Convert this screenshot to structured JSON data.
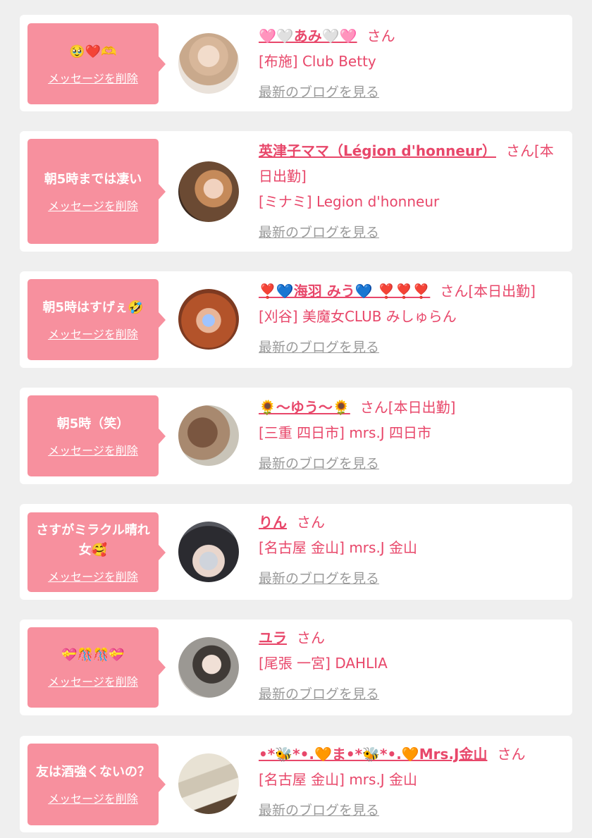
{
  "ui": {
    "delete_label": "メッセージを削除",
    "blog_label": "最新のブログを見る"
  },
  "messages": [
    {
      "message": "🥹❤️🫶",
      "name": "🩷🤍あみ🤍🩷",
      "honorific": "さん",
      "shop": "[布施] Club Betty",
      "avatar": "avatar-blonde-woman"
    },
    {
      "message": "朝5時までは凄い",
      "name": "英津子ママ（Légion d'honneur）",
      "honorific": "さん[本日出勤]",
      "shop": "[ミナミ] Legion d'honneur",
      "avatar": "avatar-woman-indoor"
    },
    {
      "message": "朝5時はすげぇ🤣",
      "name": "❣️💙海羽 みう💙 ❣️❣️❣️",
      "honorific": "さん[本日出勤]",
      "shop": "[刈谷] 美魔女CLUB みしゅらん",
      "avatar": "avatar-auburn-hair"
    },
    {
      "message": "朝5時（笑）",
      "name": "🌻～ゆう～🌻",
      "honorific": "さん[本日出勤]",
      "shop": "[三重 四日市] mrs.J 四日市",
      "avatar": "avatar-long-wavy-hair"
    },
    {
      "message": "さすがミラクル晴れ女🥰",
      "name": "りん",
      "honorific": "さん",
      "shop": "[名古屋 金山] mrs.J 金山",
      "avatar": "avatar-dark-hair-ng"
    },
    {
      "message": "💝🎊🎊💝",
      "name": "ユラ",
      "honorific": "さん",
      "shop": "[尾張 一宮] DAHLIA",
      "avatar": "avatar-selfie-mirror"
    },
    {
      "message": "友は酒強くないの？",
      "name": "•*🐝*•.🧡ま•*🐝*•.🧡Mrs.J金山",
      "honorific": "さん",
      "shop": "[名古屋 金山] mrs.J 金山",
      "avatar": "avatar-papers"
    }
  ]
}
